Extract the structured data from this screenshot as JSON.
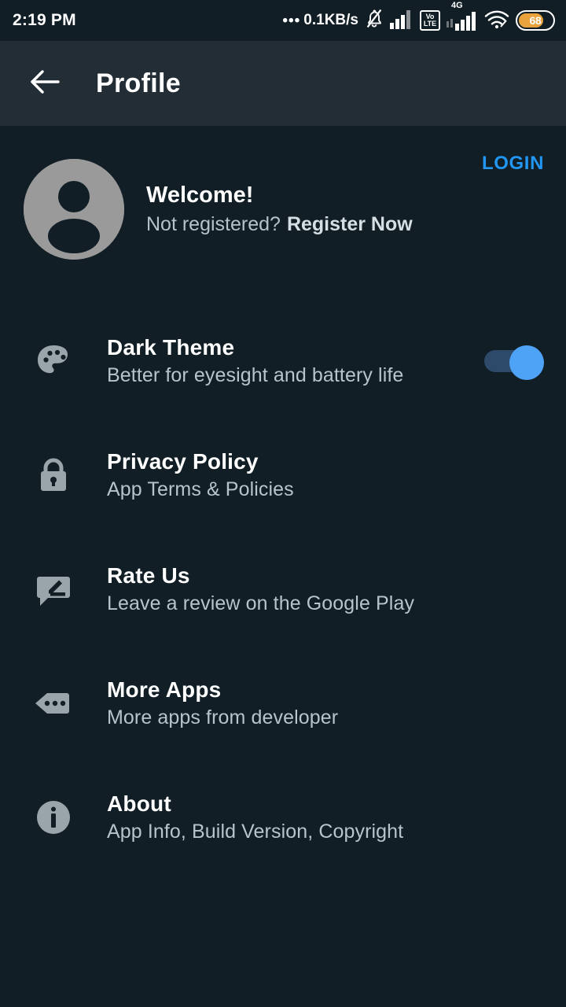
{
  "status_bar": {
    "time": "2:19 PM",
    "net_speed_dots": "•••",
    "net_speed": "0.1KB/s",
    "mute_icon": "bell-off-icon",
    "signal_icon": "signal-bars-icon",
    "volte_top": "Vo",
    "volte_bottom": "LTE",
    "network_type": "4G",
    "wifi_icon": "wifi-icon",
    "battery_level": "68",
    "battery_color": "#e8a33d"
  },
  "app_bar": {
    "back_icon": "back-arrow-icon",
    "title": "Profile"
  },
  "profile": {
    "avatar_icon": "person-avatar-icon",
    "welcome": "Welcome!",
    "not_registered": "Not registered?",
    "register_now": "Register Now",
    "login_label": "LOGIN",
    "login_color": "#2196f3"
  },
  "settings": {
    "items": [
      {
        "icon": "palette-icon",
        "title": "Dark Theme",
        "subtitle": "Better for eyesight and battery life",
        "control": "toggle",
        "toggle_on": true,
        "toggle_track_color": "#2d4a6b",
        "toggle_thumb_color": "#4fa3f7"
      },
      {
        "icon": "lock-icon",
        "title": "Privacy Policy",
        "subtitle": "App Terms & Policies",
        "control": "none"
      },
      {
        "icon": "rate-review-icon",
        "title": "Rate Us",
        "subtitle": "Leave a review on the Google Play",
        "control": "none"
      },
      {
        "icon": "more-apps-icon",
        "title": "More Apps",
        "subtitle": "More apps from developer",
        "control": "none"
      },
      {
        "icon": "info-icon",
        "title": "About",
        "subtitle": "App Info, Build Version, Copyright",
        "control": "none"
      }
    ]
  },
  "theme": {
    "background": "#111e26",
    "app_bar_background": "#232d36",
    "icon_gray": "#9aa4ab",
    "title_color": "#ffffff",
    "subtitle_color": "#b8c4cc"
  }
}
